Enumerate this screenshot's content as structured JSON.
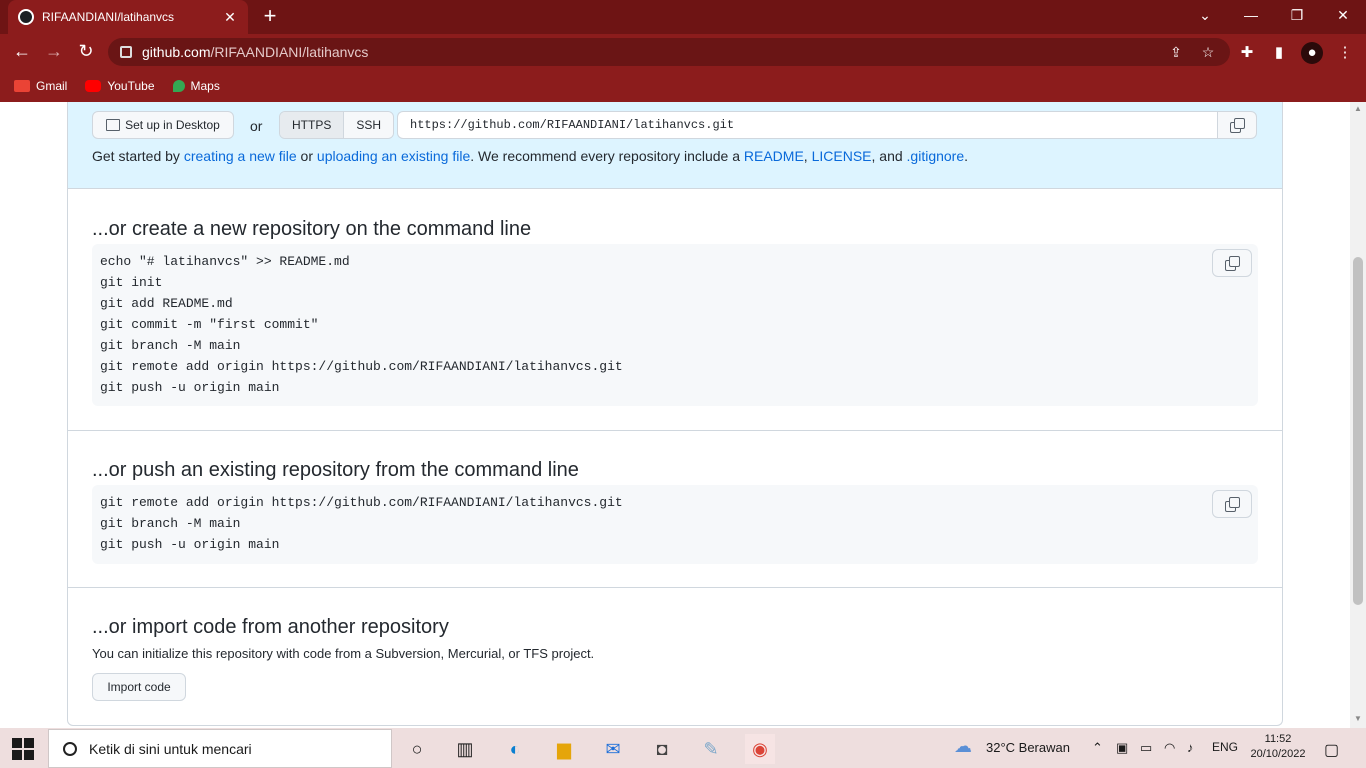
{
  "browser": {
    "tab_title": "RIFAANDIANI/latihanvcs",
    "url_host": "github.com",
    "url_path": "/RIFAANDIANI/latihanvcs",
    "bookmarks": [
      {
        "label": "Gmail",
        "icon": "gmail-icon",
        "color": "#ea4335"
      },
      {
        "label": "YouTube",
        "icon": "youtube-icon",
        "color": "#ff0000"
      },
      {
        "label": "Maps",
        "icon": "maps-icon",
        "color": "#34a853"
      }
    ]
  },
  "quick_setup": {
    "desktop_button": "Set up in Desktop",
    "or_label": "or",
    "protocol_https": "HTTPS",
    "protocol_ssh": "SSH",
    "clone_url": "https://github.com/RIFAANDIANI/latihanvcs.git",
    "getstarted": {
      "t1": "Get started by ",
      "link_new_file": "creating a new file",
      "t2": " or ",
      "link_upload": "uploading an existing file",
      "t3": ". We recommend every repository include a ",
      "link_readme": "README",
      "t4": ", ",
      "link_license": "LICENSE",
      "t5": ", and ",
      "link_gitignore": ".gitignore",
      "t6": "."
    }
  },
  "create_section": {
    "title": "...or create a new repository on the command line",
    "lines": [
      "echo \"# latihanvcs\" >> README.md",
      "git init",
      "git add README.md",
      "git commit -m \"first commit\"",
      "git branch -M main",
      "git remote add origin https://github.com/RIFAANDIANI/latihanvcs.git",
      "git push -u origin main"
    ]
  },
  "push_section": {
    "title": "...or push an existing repository from the command line",
    "lines": [
      "git remote add origin https://github.com/RIFAANDIANI/latihanvcs.git",
      "git branch -M main",
      "git push -u origin main"
    ]
  },
  "import_section": {
    "title": "...or import code from another repository",
    "description": "You can initialize this repository with code from a Subversion, Mercurial, or TFS project.",
    "button": "Import code"
  },
  "taskbar": {
    "search_placeholder": "Ketik di sini untuk mencari",
    "weather": "32°C  Berawan",
    "language": "ENG",
    "time": "11:52",
    "date": "20/10/2022"
  }
}
